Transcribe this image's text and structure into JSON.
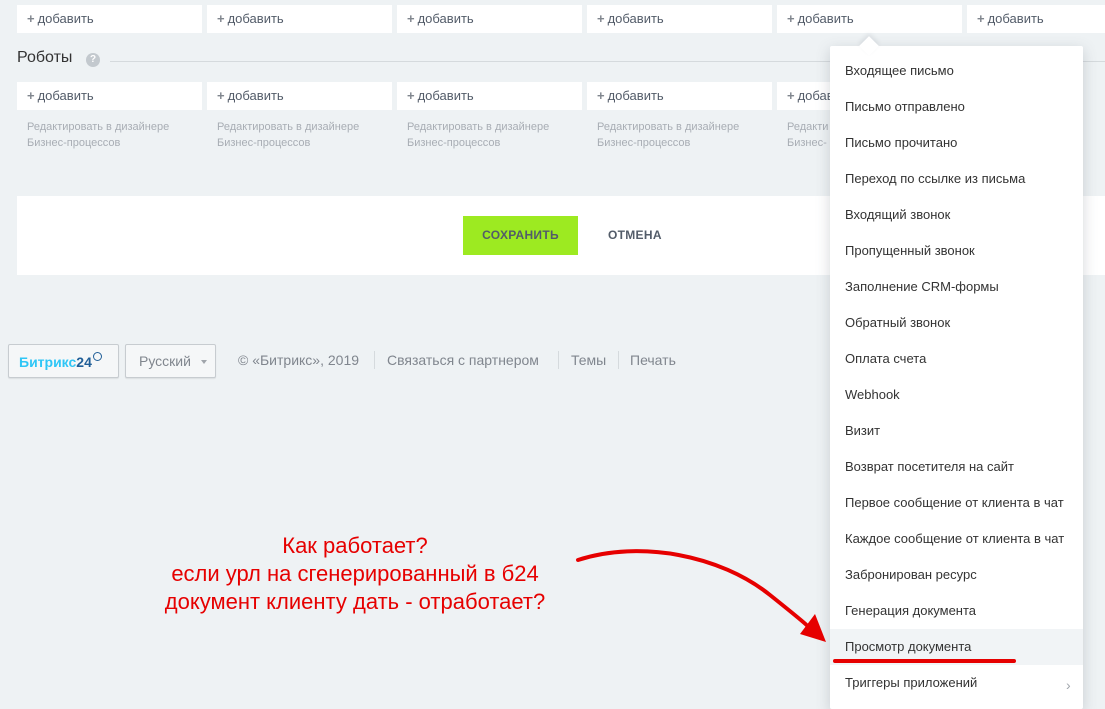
{
  "top_row": {
    "add_label": "добавить"
  },
  "robots": {
    "title": "Роботы",
    "help": "?",
    "add_label": "добавить",
    "hint_line1": "Редактировать в дизайнере",
    "hint_line2": "Бизнес-процессов",
    "hint_trunc1": "Редакти",
    "hint_trunc2": "Бизнес-"
  },
  "actions": {
    "save_label": "СОХРАНИТЬ",
    "cancel_label": "ОТМЕНА"
  },
  "footer": {
    "logo_text": "Битрикс",
    "logo_num": "24",
    "language": "Русский",
    "copyright": "© «Битрикс», 2019",
    "partner_link": "Связаться с партнером",
    "themes_link": "Темы",
    "print_link": "Печать"
  },
  "menu": {
    "items": [
      "Входящее письмо",
      "Письмо отправлено",
      "Письмо прочитано",
      "Переход по ссылке из письма",
      "Входящий звонок",
      "Пропущенный звонок",
      "Заполнение CRM-формы",
      "Обратный звонок",
      "Оплата счета",
      "Webhook",
      "Визит",
      "Возврат посетителя на сайт",
      "Первое сообщение от клиента в чат",
      "Каждое сообщение от клиента в чат",
      "Забронирован ресурс",
      "Генерация документа",
      "Просмотр документа",
      "Триггеры приложений"
    ],
    "submenu_arrow": "›"
  },
  "annotation": {
    "line1": "Как работает?",
    "line2": "если урл на сгенерированный в б24",
    "line3": "документ клиенту дать - отработает?",
    "color": "#e60000"
  },
  "colors": {
    "save_button": "#9dea21",
    "background": "#eef2f4"
  }
}
